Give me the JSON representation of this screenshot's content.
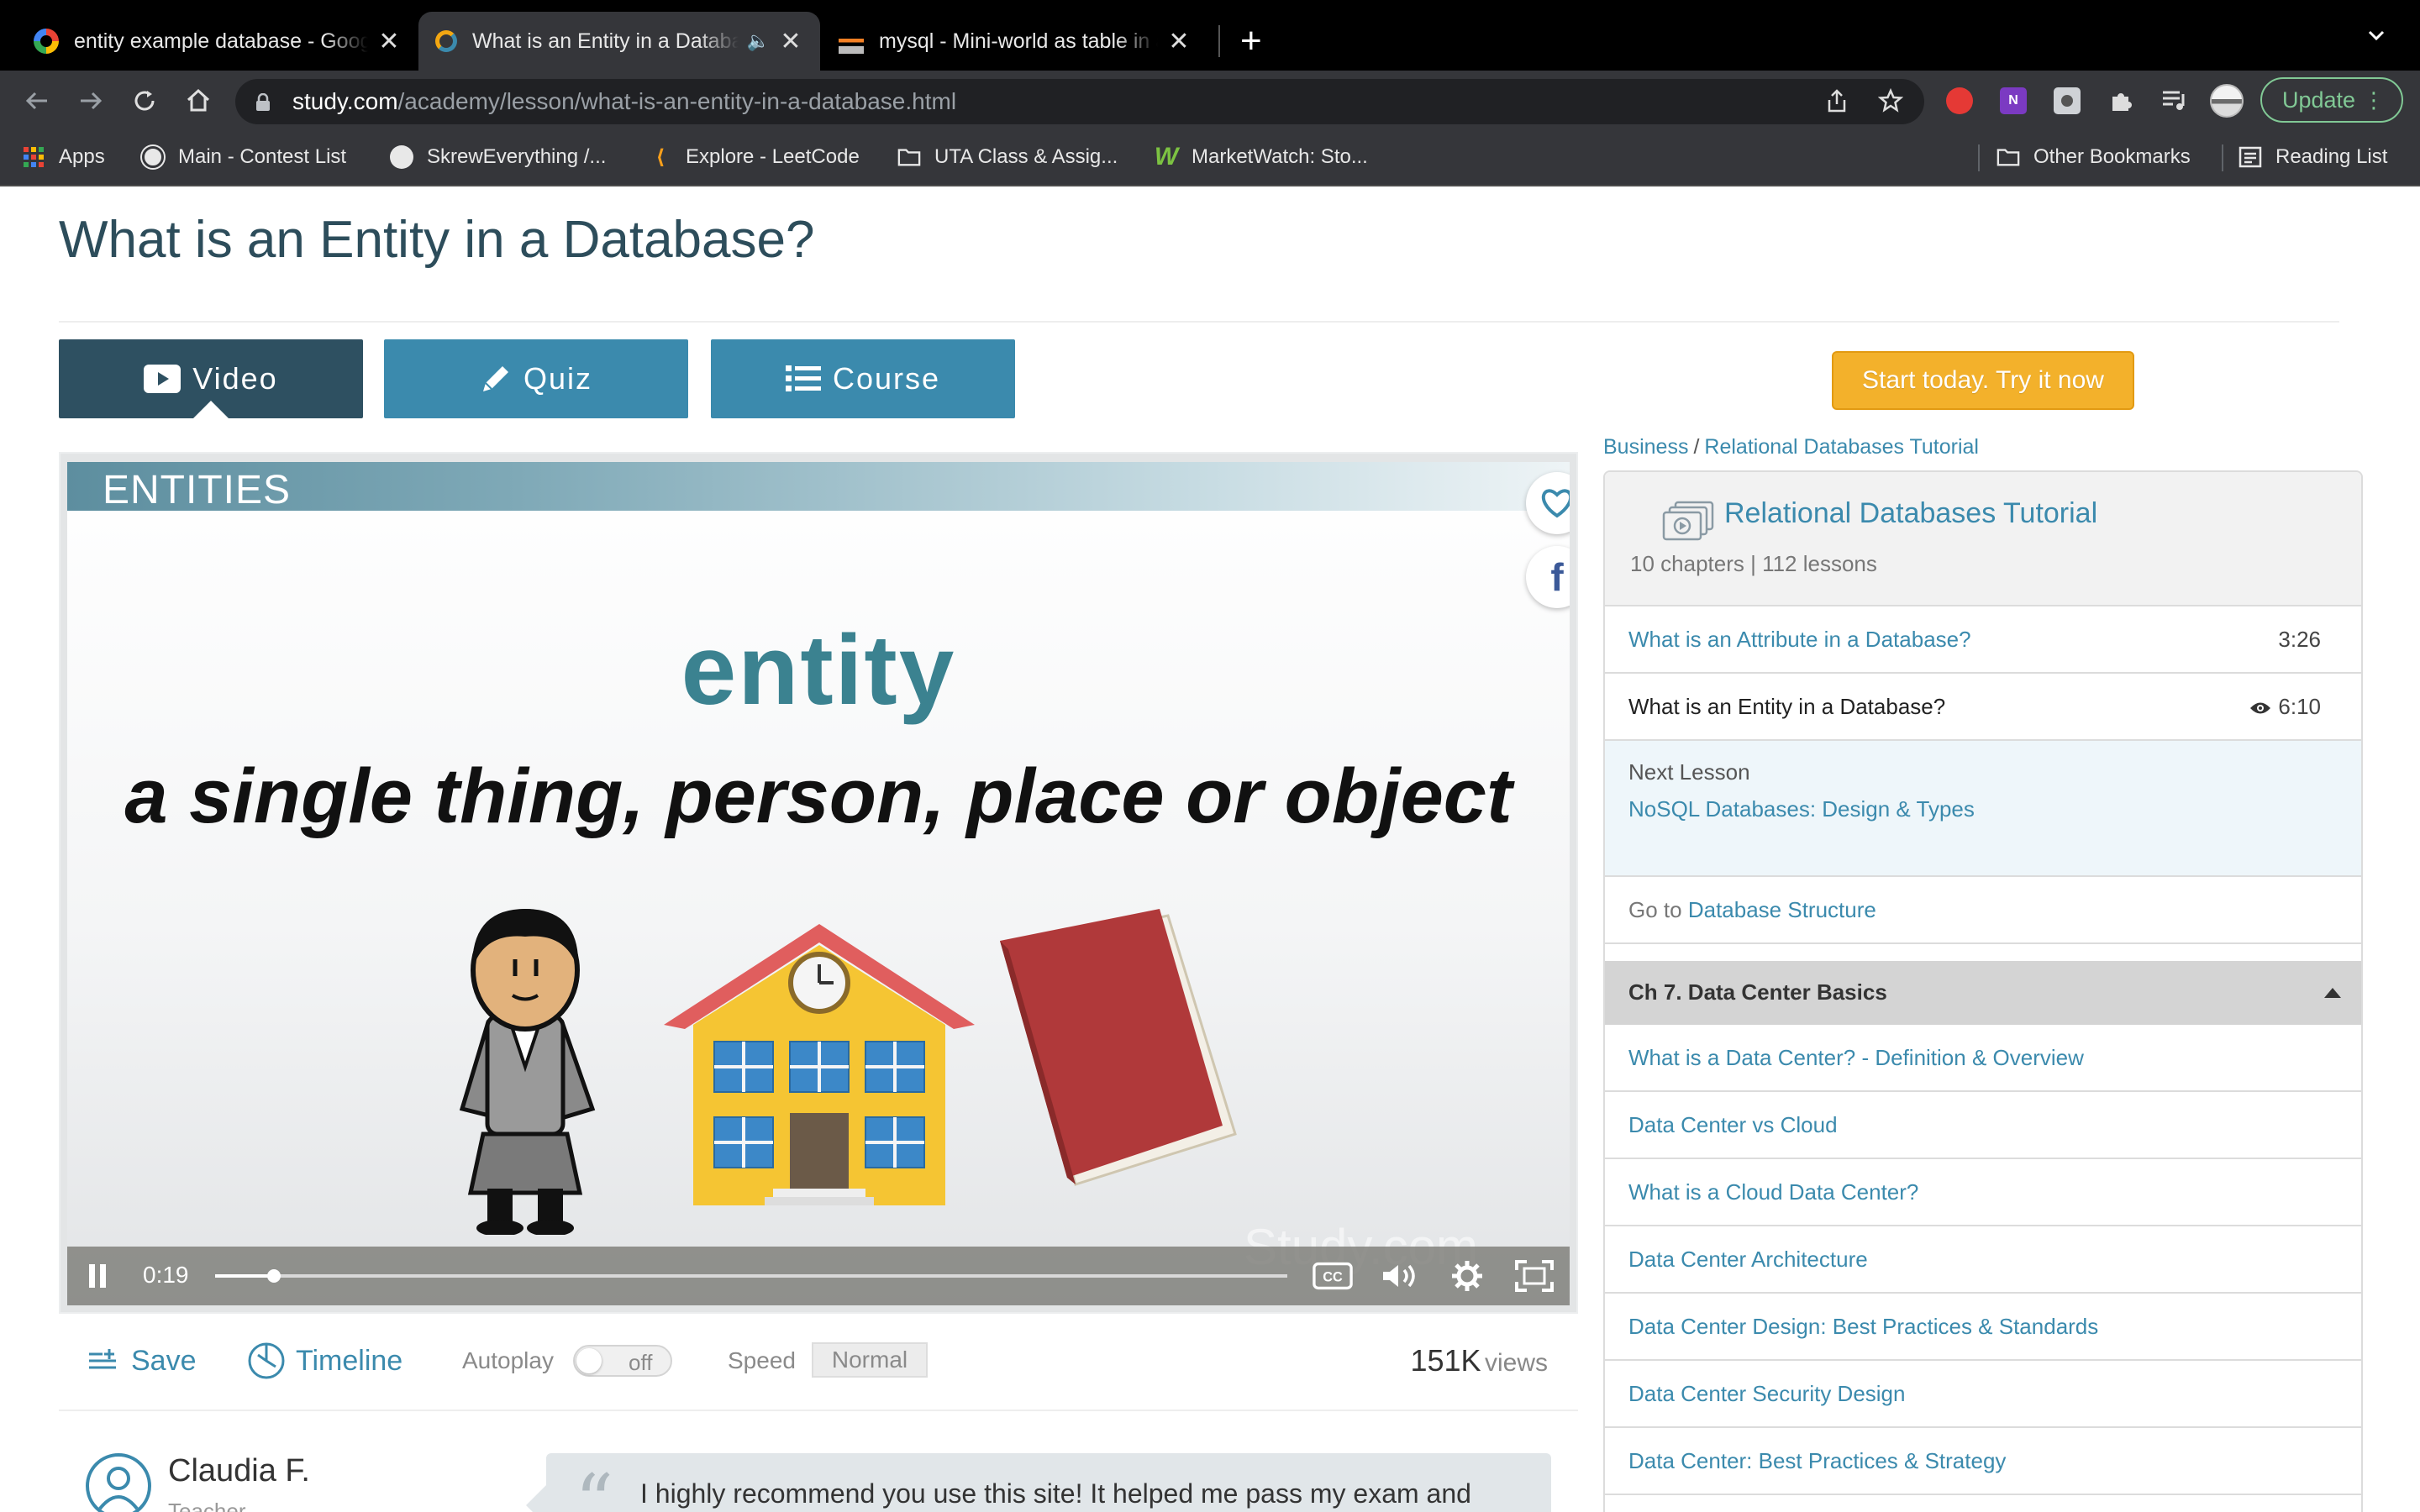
{
  "browser": {
    "tabs": [
      {
        "title": "entity example database - Google Search",
        "active": false
      },
      {
        "title": "What is an Entity in a Database?",
        "active": true,
        "muted_icon": "speaker-icon"
      },
      {
        "title": "mysql - Mini-world as table in a database",
        "active": false
      }
    ],
    "new_tab_label": "+",
    "url_domain": "study.com",
    "url_path": "/academy/lesson/what-is-an-entity-in-a-database.html",
    "update_label": "Update",
    "bookmarks": [
      {
        "label": "Apps",
        "icon": "apps-grid-icon"
      },
      {
        "label": "Main - Contest List",
        "icon": "globe-icon"
      },
      {
        "label": "SkrewEverything /...",
        "icon": "github-icon"
      },
      {
        "label": "Explore - LeetCode",
        "icon": "leetcode-icon"
      },
      {
        "label": "UTA Class & Assig...",
        "icon": "folder-icon"
      },
      {
        "label": "MarketWatch: Sto...",
        "icon": "marketwatch-icon"
      }
    ],
    "other_bookmarks_label": "Other Bookmarks",
    "reading_list_label": "Reading List"
  },
  "page": {
    "title": "What is an Entity in a Database?",
    "tabs": [
      {
        "label": "Video",
        "icon": "play-icon"
      },
      {
        "label": "Quiz",
        "icon": "pencil-icon"
      },
      {
        "label": "Course",
        "icon": "list-icon"
      }
    ],
    "cta_label": "Start today. Try it now"
  },
  "video": {
    "slide_header": "ENTITIES",
    "slide_word": "entity",
    "slide_definition": "a single thing, person, place or object",
    "watermark": "Study.com",
    "time": "0:19",
    "progress": 0.055
  },
  "under_video": {
    "save_label": "Save",
    "timeline_label": "Timeline",
    "autoplay_label": "Autoplay",
    "autoplay_state": "off",
    "speed_label": "Speed",
    "speed_value": "Normal",
    "views_count": "151K",
    "views_label": "views"
  },
  "testimonial": {
    "name": "Claudia F.",
    "role": "Teacher",
    "quote_mark": "“",
    "quote": "I highly recommend you use this site! It helped me pass my exam and"
  },
  "sidebar": {
    "breadcrumb": {
      "root": "Business",
      "sep": "/",
      "leaf": "Relational Databases Tutorial"
    },
    "course_title": "Relational Databases Tutorial",
    "course_meta": "10 chapters | 112 lessons",
    "prev_lesson": {
      "title": "What is an Attribute in a Database?",
      "duration": "3:26"
    },
    "current_lesson": {
      "title": "What is an Entity in a Database?",
      "duration": "6:10"
    },
    "next_label": "Next Lesson",
    "next_title": "NoSQL Databases: Design & Types",
    "goto_prefix": "Go to",
    "goto_target": "Database Structure",
    "chapter_title": "Ch 7. Data Center Basics",
    "chapter_lessons": [
      "What is a Data Center? - Definition & Overview",
      "Data Center vs Cloud",
      "What is a Cloud Data Center?",
      "Data Center Architecture",
      "Data Center Design: Best Practices & Standards",
      "Data Center Security Design",
      "Data Center: Best Practices & Strategy"
    ]
  }
}
